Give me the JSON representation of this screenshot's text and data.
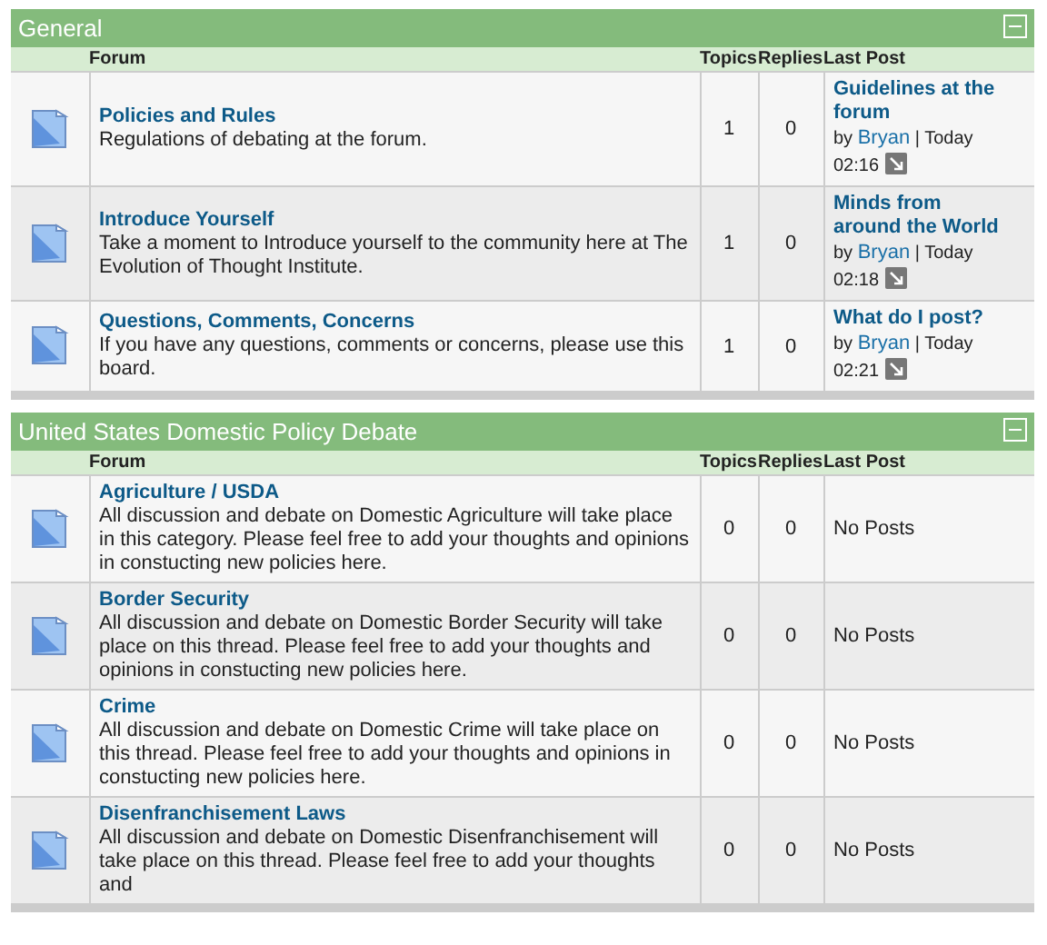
{
  "sections": [
    {
      "title": "General",
      "columns": [
        "Forum",
        "Topics",
        "Replies",
        "Last Post"
      ],
      "forums": [
        {
          "title": "Policies and Rules",
          "description": "Regulations of debating at the forum.",
          "topics": "1",
          "replies": "0",
          "last_post": {
            "kind": "post",
            "title": "Guidelines at the forum",
            "by": "by",
            "author": "Bryan",
            "day": "| Today",
            "time": "02:16"
          }
        },
        {
          "title": "Introduce Yourself",
          "description": "Take a moment to Introduce yourself to the community here at The Evolution of Thought Institute.",
          "topics": "1",
          "replies": "0",
          "last_post": {
            "kind": "post",
            "title": "Minds from around the World",
            "by": "by",
            "author": "Bryan",
            "day": "| Today",
            "time": "02:18"
          }
        },
        {
          "title": "Questions, Comments, Concerns",
          "description": "If you have any questions, comments or concerns, please use this board.",
          "topics": "1",
          "replies": "0",
          "last_post": {
            "kind": "post",
            "title": "What do I post?",
            "by": "by",
            "author": "Bryan",
            "day": "| Today",
            "time": "02:21"
          }
        }
      ]
    },
    {
      "title": "United States Domestic Policy Debate",
      "columns": [
        "Forum",
        "Topics",
        "Replies",
        "Last Post"
      ],
      "forums": [
        {
          "title": "Agriculture / USDA",
          "description": "All discussion and debate on Domestic Agriculture will take place in this category. Please feel free to add your thoughts and opinions in constucting new policies here.",
          "topics": "0",
          "replies": "0",
          "last_post": {
            "kind": "none",
            "text": "No Posts"
          }
        },
        {
          "title": "Border Security",
          "description": "All discussion and debate on Domestic Border Security will take place on this thread. Please feel free to add your thoughts and opinions in constucting new policies here.",
          "topics": "0",
          "replies": "0",
          "last_post": {
            "kind": "none",
            "text": "No Posts"
          }
        },
        {
          "title": "Crime",
          "description": "All discussion and debate on Domestic Crime will take place on this thread. Please feel free to add your thoughts and opinions in constucting new policies here.",
          "topics": "0",
          "replies": "0",
          "last_post": {
            "kind": "none",
            "text": "No Posts"
          }
        },
        {
          "title": "Disenfranchisement Laws",
          "description": "All discussion and debate on Domestic Disenfranchisement will take place on this thread. Please feel free to add your thoughts and",
          "topics": "0",
          "replies": "0",
          "last_post": {
            "kind": "none",
            "text": "No Posts"
          }
        }
      ]
    }
  ]
}
